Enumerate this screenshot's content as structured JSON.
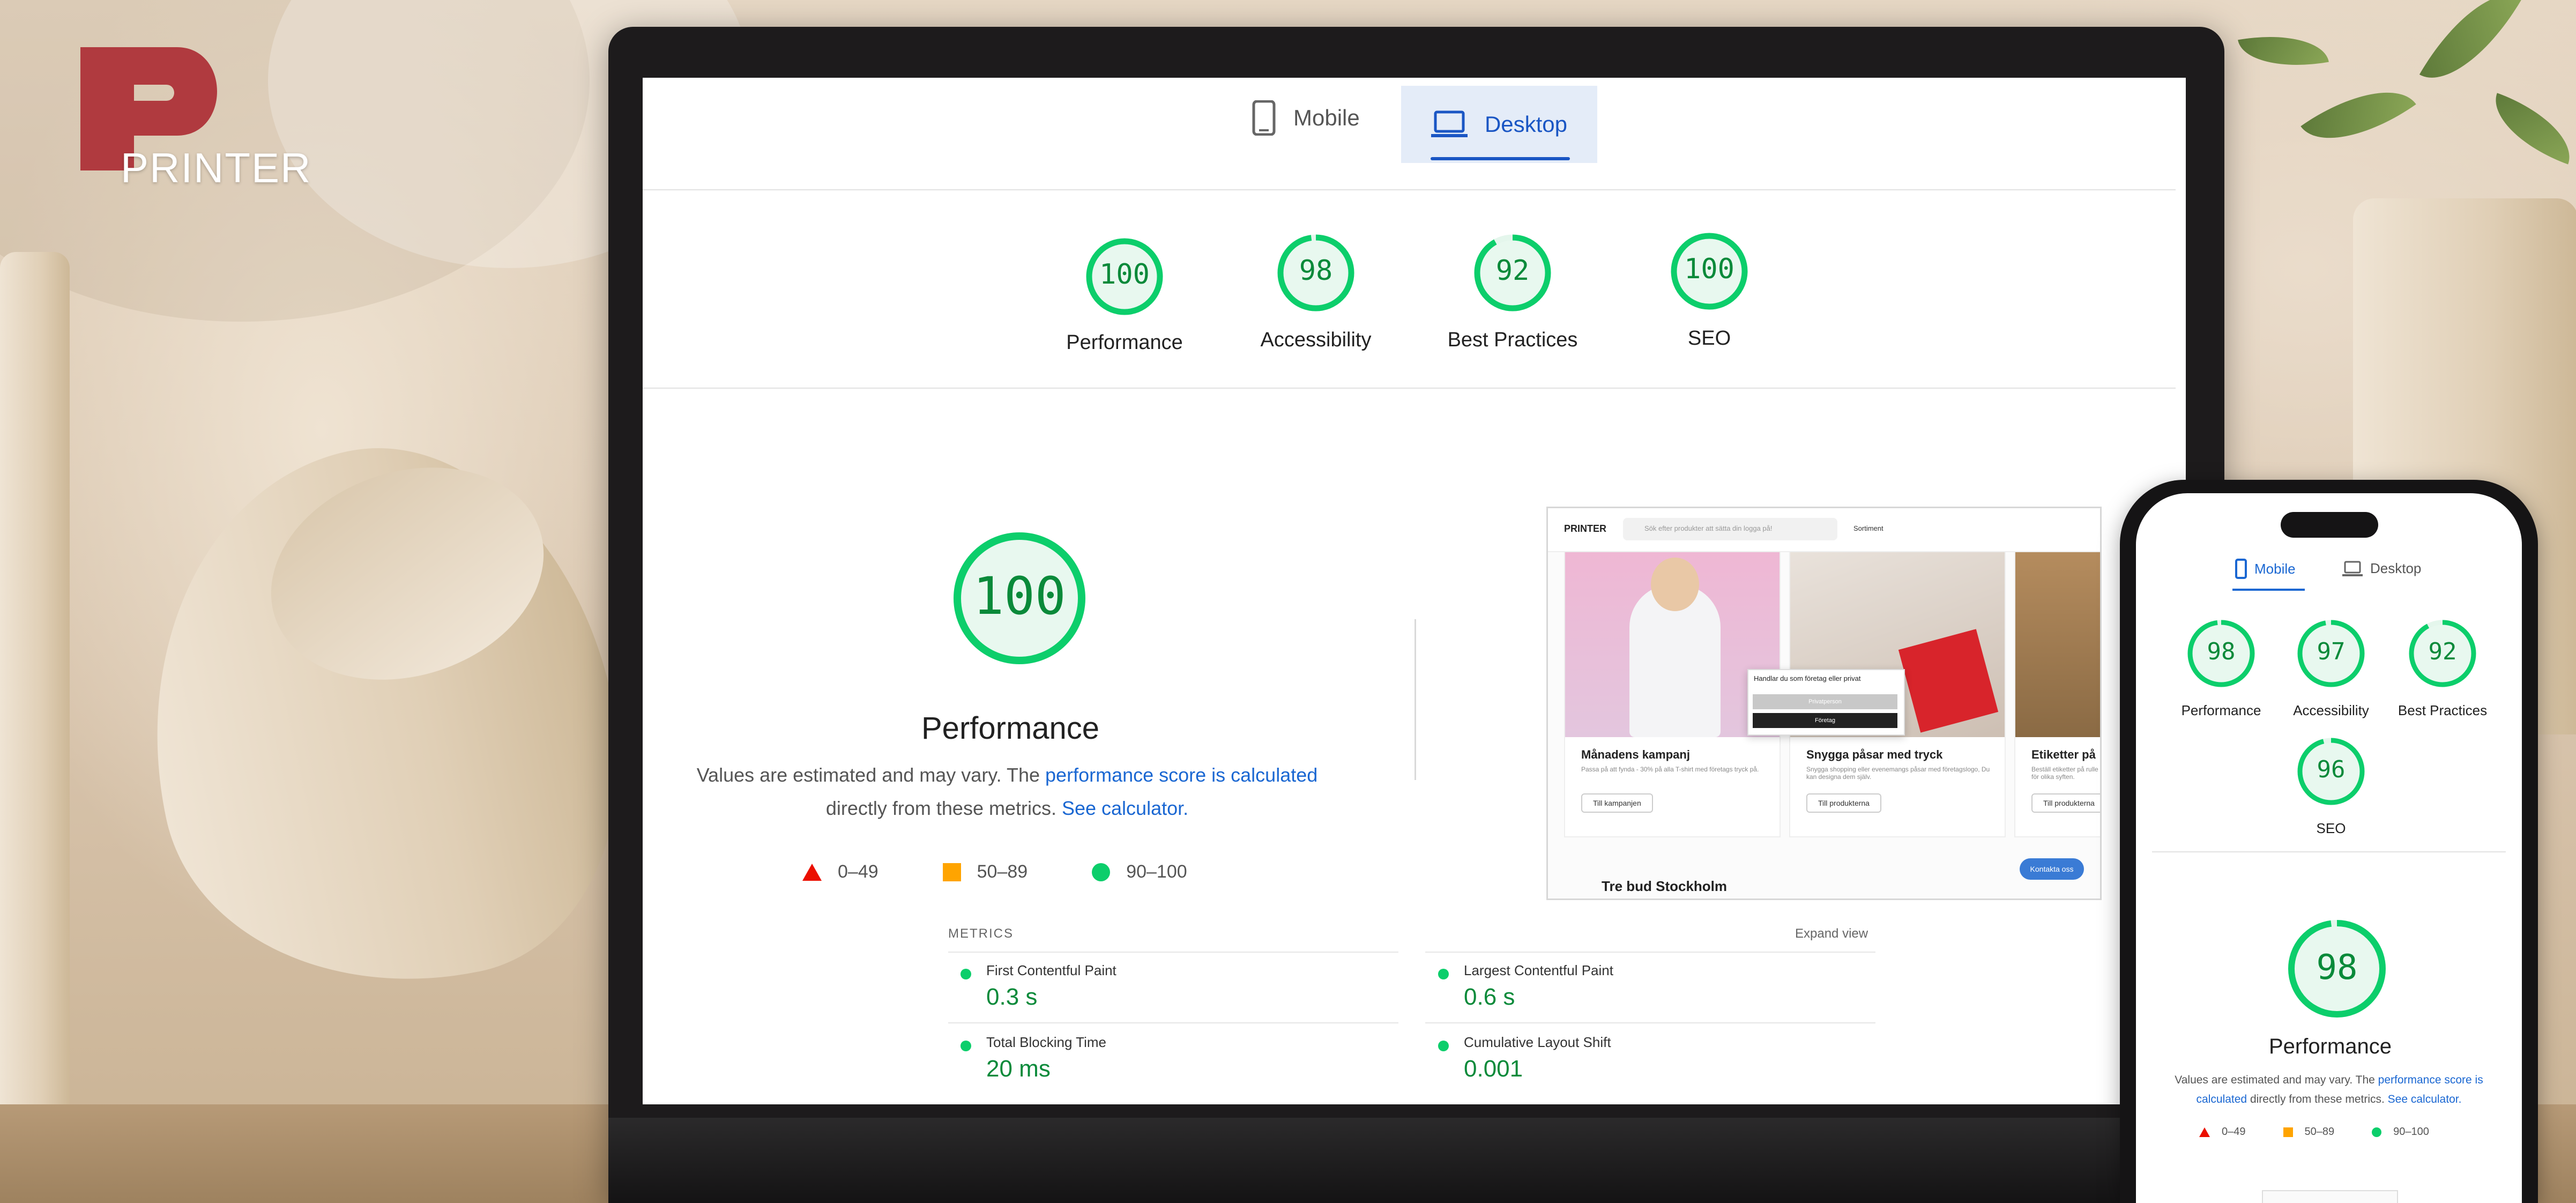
{
  "brand": {
    "logo_text": "PRINTER",
    "accent": "#b03a3f"
  },
  "laptop": {
    "tabs": [
      {
        "label": "Mobile",
        "icon": "smartphone-icon",
        "selected": false
      },
      {
        "label": "Desktop",
        "icon": "laptop-icon",
        "selected": true
      }
    ],
    "scores": [
      {
        "label": "Performance",
        "value": "100"
      },
      {
        "label": "Accessibility",
        "value": "98"
      },
      {
        "label": "Best Practices",
        "value": "92"
      },
      {
        "label": "SEO",
        "value": "100"
      }
    ],
    "main": {
      "score": "100",
      "title": "Performance",
      "desc_before": "Values are estimated and may vary. The ",
      "desc_link1": "performance score is calculated",
      "desc_middle": "directly from these metrics. ",
      "desc_link2": "See calculator."
    },
    "legend": [
      {
        "range": "0–49",
        "shape": "triangle",
        "color": "#eb0f00"
      },
      {
        "range": "50–89",
        "shape": "square",
        "color": "#ffa400"
      },
      {
        "range": "90–100",
        "shape": "circle",
        "color": "#0cce6b"
      }
    ],
    "metrics": {
      "heading": "METRICS",
      "expand": "Expand view",
      "items": [
        {
          "name": "First Contentful Paint",
          "value": "0.3 s"
        },
        {
          "name": "Largest Contentful Paint",
          "value": "0.6 s"
        },
        {
          "name": "Total Blocking Time",
          "value": "20 ms"
        },
        {
          "name": "Cumulative Layout Shift",
          "value": "0.001"
        }
      ]
    },
    "thumbnail": {
      "brand": "PRINTER",
      "search_placeholder": "Sök efter produkter att sätta din logga på!",
      "menu_label": "Sortiment",
      "cards": [
        {
          "title": "Månadens kampanj",
          "sub": "Passa på att fynda - 30% på alla T-shirt med företags tryck på.",
          "button": "Till kampanjen"
        },
        {
          "title": "Snygga påsar med tryck",
          "sub": "Snygga shopping eller evenemangs påsar med företagslogo, Du kan designa dem själv.",
          "button": "Till produkterna"
        },
        {
          "title": "Etiketter på",
          "sub": "Beställ etiketter på rulle för olika syften.",
          "button": "Till produkterna"
        }
      ],
      "popup_title": "Handlar du som företag eller privat",
      "popup_btn1": "Privatperson",
      "popup_btn2": "Företag",
      "chat_label": "Kontakta oss",
      "bottom_text": "Tre bud Stockholm"
    }
  },
  "phone": {
    "tabs": [
      {
        "label": "Mobile",
        "icon": "smartphone-icon",
        "selected": true
      },
      {
        "label": "Desktop",
        "icon": "laptop-icon",
        "selected": false
      }
    ],
    "scores": [
      {
        "label": "Performance",
        "value": "98"
      },
      {
        "label": "Accessibility",
        "value": "97"
      },
      {
        "label": "Best Practices",
        "value": "92"
      },
      {
        "label": "SEO",
        "value": "96"
      }
    ],
    "main": {
      "score": "98",
      "title": "Performance",
      "desc_before": "Values are estimated and may vary. The ",
      "desc_link1": "performance score is",
      "desc_link1b": "calculated",
      "desc_middle": " directly from these metrics. ",
      "desc_link2": "See calculator."
    },
    "legend": [
      {
        "range": "0–49"
      },
      {
        "range": "50–89"
      },
      {
        "range": "90–100"
      }
    ]
  },
  "colors": {
    "good": "#0cce6b",
    "good_text": "#0a8a3a",
    "link": "#1a67d2",
    "tab_active_bg": "#e4ecf8"
  }
}
